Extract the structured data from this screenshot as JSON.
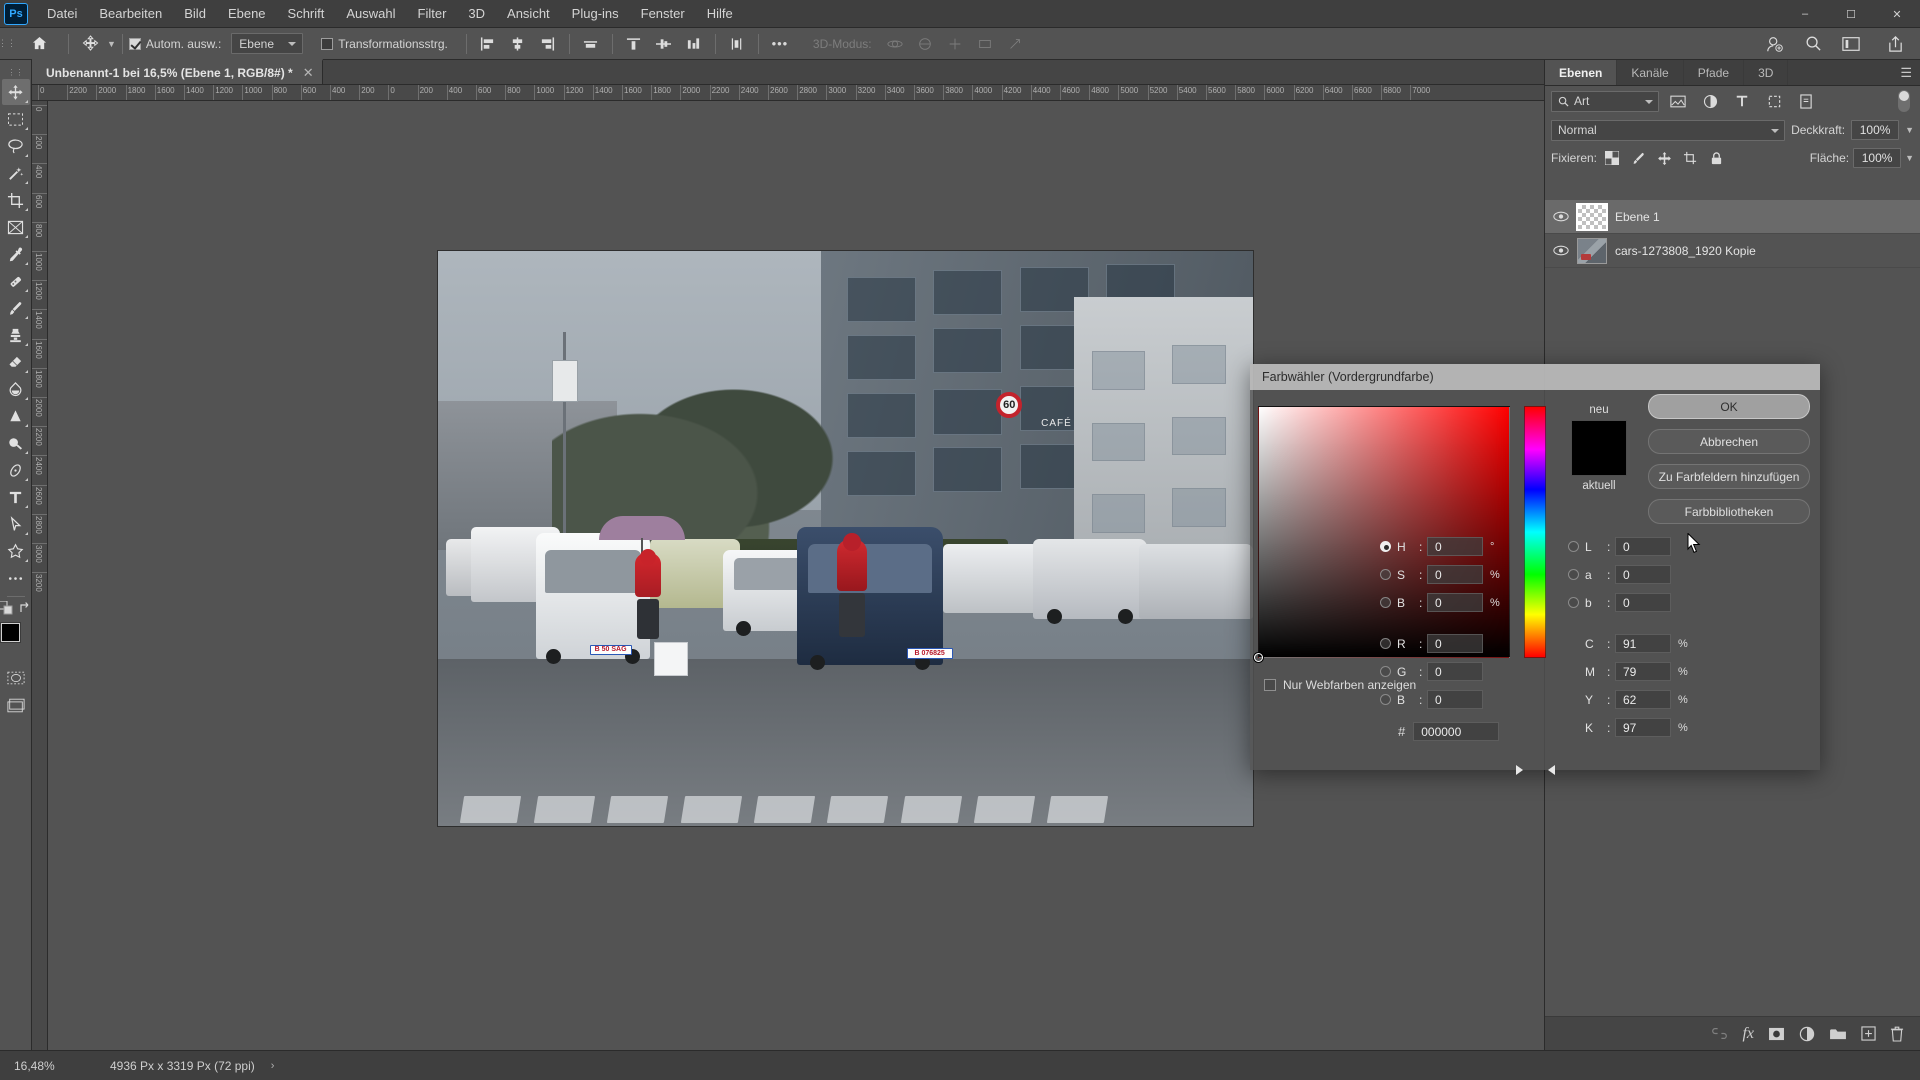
{
  "app": {
    "name": "Adobe Photoshop",
    "logo_text": "Ps"
  },
  "menubar": {
    "items": [
      {
        "label": "Datei"
      },
      {
        "label": "Bearbeiten"
      },
      {
        "label": "Bild"
      },
      {
        "label": "Ebene"
      },
      {
        "label": "Schrift"
      },
      {
        "label": "Auswahl"
      },
      {
        "label": "Filter"
      },
      {
        "label": "3D"
      },
      {
        "label": "Ansicht"
      },
      {
        "label": "Plug-ins"
      },
      {
        "label": "Fenster"
      },
      {
        "label": "Hilfe"
      }
    ],
    "window_controls": {
      "minimize": "–",
      "maximize": "☐",
      "close": "✕"
    }
  },
  "options_bar": {
    "home_icon": "home-icon",
    "tool_icon": "move-tool-icon",
    "auto_select_label": "Autom. ausw.:",
    "auto_select_checked": true,
    "scope_value": "Ebene",
    "transform_controls_label": "Transformationsstrg.",
    "transform_controls_checked": false,
    "align_group_1": [
      "align-left-edges",
      "align-horizontal-centers",
      "align-right-edges"
    ],
    "align_group_2": [
      "align-top-edges"
    ],
    "distribute_group": [
      "distribute-top",
      "distribute-vertical-centers",
      "distribute-bottom",
      "distribute-spacing"
    ],
    "more_label": "•••",
    "mode_3d_label": "3D-Modus:",
    "right_icons": [
      "add-person-icon",
      "search-icon",
      "workspace-icon",
      "share-icon"
    ]
  },
  "document": {
    "tab_title": "Unbenannt-1 bei 16,5% (Ebene 1, RGB/8#) *",
    "close_glyph": "✕"
  },
  "rulers": {
    "horizontal_ticks": [
      "0",
      "2200",
      "2000",
      "1800",
      "1600",
      "1400",
      "1200",
      "1000",
      "800",
      "600",
      "400",
      "200",
      "0",
      "200",
      "400",
      "600",
      "800",
      "1000",
      "1200",
      "1400",
      "1600",
      "1800",
      "2000",
      "2200",
      "2400",
      "2600",
      "2800",
      "3000",
      "3200",
      "3400",
      "3600",
      "3800",
      "4000",
      "4200",
      "4400",
      "4600",
      "4800",
      "5000",
      "5200",
      "5400",
      "5600",
      "5800",
      "6000",
      "6200",
      "6400",
      "6600",
      "6800",
      "7000"
    ],
    "vertical_ticks": [
      "0",
      "200",
      "400",
      "600",
      "800",
      "1000",
      "1200",
      "1400",
      "1600",
      "1800",
      "2000",
      "2200",
      "2400",
      "2600",
      "2800",
      "3000",
      "3200"
    ]
  },
  "toolbar": {
    "tools": [
      {
        "name": "move-tool",
        "active": true
      },
      {
        "name": "rectangular-marquee-tool",
        "active": false
      },
      {
        "name": "lasso-tool",
        "active": false
      },
      {
        "name": "magic-wand-tool",
        "active": false
      },
      {
        "name": "crop-tool",
        "active": false
      },
      {
        "name": "frame-tool",
        "active": false
      },
      {
        "name": "eyedropper-tool",
        "active": false
      },
      {
        "name": "spot-healing-brush-tool",
        "active": false
      },
      {
        "name": "brush-tool",
        "active": false
      },
      {
        "name": "clone-stamp-tool",
        "active": false
      },
      {
        "name": "eraser-tool",
        "active": false
      },
      {
        "name": "gradient-tool",
        "active": false
      },
      {
        "name": "blur-tool",
        "active": false
      },
      {
        "name": "dodge-tool",
        "active": false
      },
      {
        "name": "pen-tool",
        "active": false
      },
      {
        "name": "type-tool",
        "active": false
      },
      {
        "name": "path-selection-tool",
        "active": false
      },
      {
        "name": "custom-shape-tool",
        "active": false
      },
      {
        "name": "edit-toolbar",
        "active": false
      }
    ],
    "foreground_color": "#000000",
    "background_color": "#ffffff",
    "quick_mask_name": "quick-mask-mode",
    "screen_mode_name": "screen-mode"
  },
  "statusbar": {
    "zoom": "16,48%",
    "dimensions": "4936 Px x 3319 Px (72 ppi)",
    "caret": "›"
  },
  "layers_panel": {
    "tabs": [
      {
        "label": "Ebenen",
        "active": true
      },
      {
        "label": "Kanäle",
        "active": false
      },
      {
        "label": "Pfade",
        "active": false
      },
      {
        "label": "3D",
        "active": false
      }
    ],
    "menu_glyph": "☰",
    "filter": {
      "search_icon": "search-icon",
      "kind_value": "Art",
      "icons": [
        "pixel-filter-icon",
        "adjustment-filter-icon",
        "type-filter-icon",
        "shape-filter-icon",
        "smart-object-filter-icon"
      ],
      "toggle_name": "filter-enable-toggle"
    },
    "blend_mode": "Normal",
    "opacity_label": "Deckkraft:",
    "opacity_value": "100%",
    "lock_label": "Fixieren:",
    "lock_icons": [
      "lock-transparent-pixels-icon",
      "lock-image-pixels-icon",
      "lock-position-icon",
      "lock-artboard-nesting-icon",
      "lock-all-icon"
    ],
    "fill_label": "Fläche:",
    "fill_value": "100%",
    "layers": [
      {
        "name": "Ebene 1",
        "visible": true,
        "selected": true,
        "thumb": "transparent"
      },
      {
        "name": "cars-1273808_1920 Kopie",
        "visible": true,
        "selected": false,
        "thumb": "photo"
      }
    ],
    "footer_icons": [
      "link-layers-icon",
      "layer-style-fx-icon",
      "add-layer-mask-icon",
      "new-adjustment-layer-icon",
      "new-group-icon",
      "new-layer-icon",
      "delete-layer-icon"
    ],
    "footer_fx_label": "fx"
  },
  "color_picker": {
    "title": "Farbwähler (Vordergrundfarbe)",
    "buttons": [
      {
        "label": "OK",
        "primary": true
      },
      {
        "label": "Abbrechen",
        "primary": false
      },
      {
        "label": "Zu Farbfeldern hinzufügen",
        "primary": false
      },
      {
        "label": "Farbbibliotheken",
        "primary": false
      }
    ],
    "swatch_new_label": "neu",
    "swatch_current_label": "aktuell",
    "swatch_color": "#000000",
    "web_colors_label": "Nur Webfarben anzeigen",
    "web_colors_checked": false,
    "hsb": [
      {
        "key": "H",
        "value": "0",
        "unit": "°",
        "selected": true
      },
      {
        "key": "S",
        "value": "0",
        "unit": "%",
        "selected": false
      },
      {
        "key": "B",
        "value": "0",
        "unit": "%",
        "selected": false
      }
    ],
    "rgb": [
      {
        "key": "R",
        "value": "0",
        "unit": "",
        "selected": false
      },
      {
        "key": "G",
        "value": "0",
        "unit": "",
        "selected": false
      },
      {
        "key": "B",
        "value": "0",
        "unit": "",
        "selected": false
      }
    ],
    "lab": [
      {
        "key": "L",
        "value": "0",
        "unit": "",
        "selected": false
      },
      {
        "key": "a",
        "value": "0",
        "unit": "",
        "selected": false
      },
      {
        "key": "b",
        "value": "0",
        "unit": "",
        "selected": false
      }
    ],
    "cmyk": [
      {
        "key": "C",
        "value": "91",
        "unit": "%"
      },
      {
        "key": "M",
        "value": "79",
        "unit": "%"
      },
      {
        "key": "Y",
        "value": "62",
        "unit": "%"
      },
      {
        "key": "K",
        "value": "97",
        "unit": "%"
      }
    ],
    "hex_prefix": "#",
    "hex_value": "000000"
  },
  "canvas_image": {
    "description": "street-photo-cars-pedestrians",
    "sign_text": "60",
    "cafe_text": "CAFÉ",
    "plate_left": "B 50 SAG",
    "plate_right": "B 076825"
  }
}
